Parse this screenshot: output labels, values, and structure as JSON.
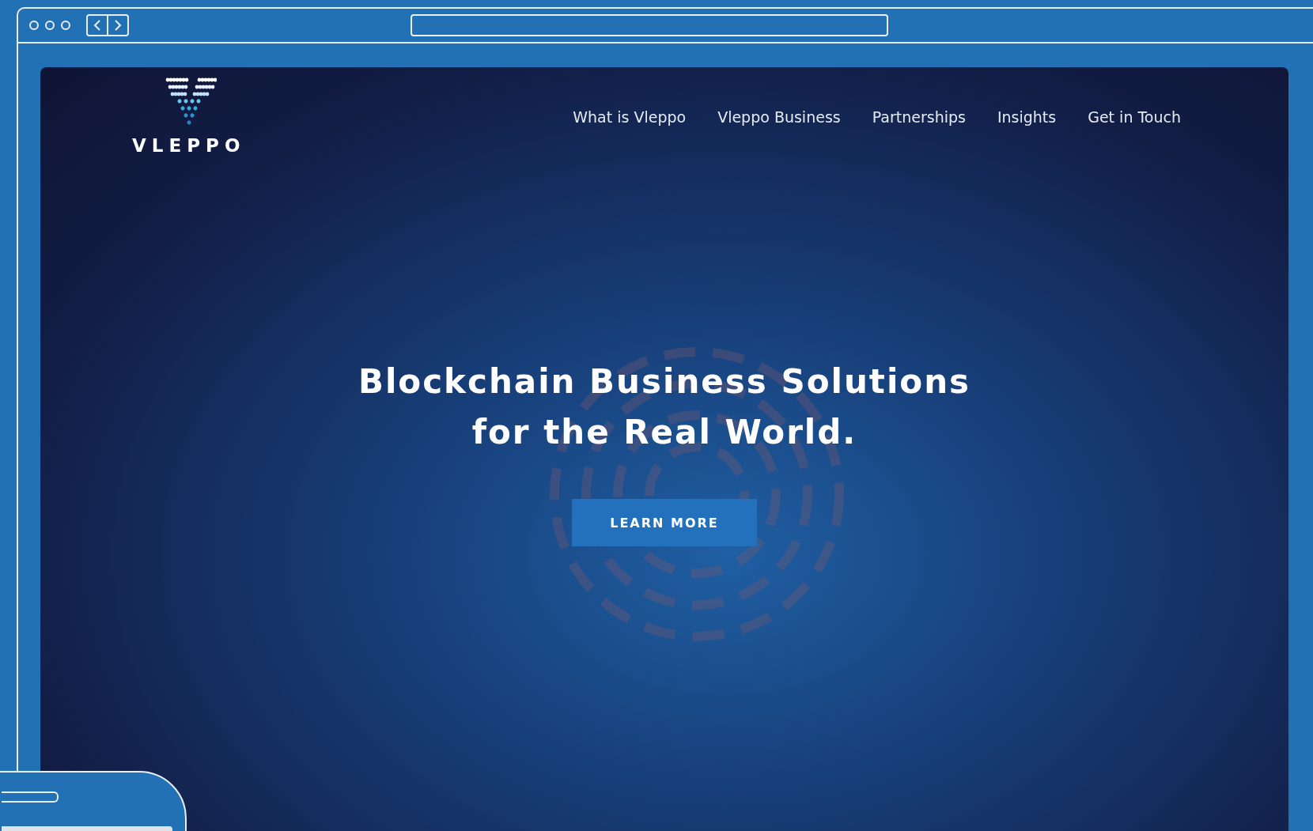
{
  "logo": {
    "text": "VLEPPO"
  },
  "nav": [
    {
      "label": "What is Vleppo"
    },
    {
      "label": "Vleppo Business"
    },
    {
      "label": "Partnerships"
    },
    {
      "label": "Insights"
    },
    {
      "label": "Get in Touch"
    }
  ],
  "hero": {
    "headline": [
      "Blockchain Business Solutions",
      "for the Real World."
    ],
    "button": "LEARN MORE"
  }
}
